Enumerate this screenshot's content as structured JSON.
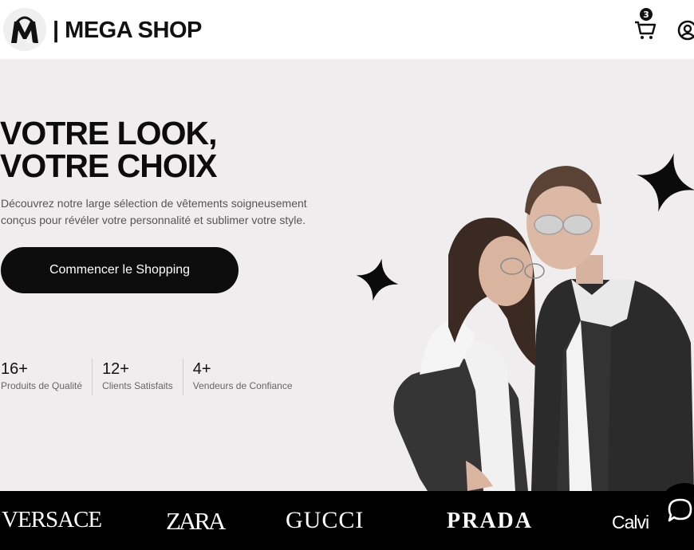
{
  "header": {
    "brand_name": "| MEGA SHOP",
    "logo_icon": "shopping-bag-m-logo",
    "cart_icon": "cart-icon",
    "cart_count": "3",
    "user_icon": "user-circle-icon"
  },
  "hero": {
    "title_line1": "VOTRE LOOK,",
    "title_line2": "VOTRE CHOIX",
    "description": "Découvrez notre large sélection de vêtements soigneusement conçus pour révéler votre personnalité et sublimer votre style.",
    "cta_label": "Commencer le Shopping",
    "stats": [
      {
        "value": "16+",
        "label": "Produits de Qualité"
      },
      {
        "value": "12+",
        "label": "Clients Satisfaits"
      },
      {
        "value": "4+",
        "label": "Vendeurs de Confiance"
      }
    ],
    "image_icon": "fashion-couple-image"
  },
  "brands": [
    "VERSACE",
    "ZARA",
    "GUCCI",
    "PRADA",
    "Calvi"
  ],
  "chat_icon": "chat-bubble-icon",
  "colors": {
    "hero_bg": "#efedee",
    "accent": "#0d0d0d",
    "strip_bg": "#000000"
  }
}
